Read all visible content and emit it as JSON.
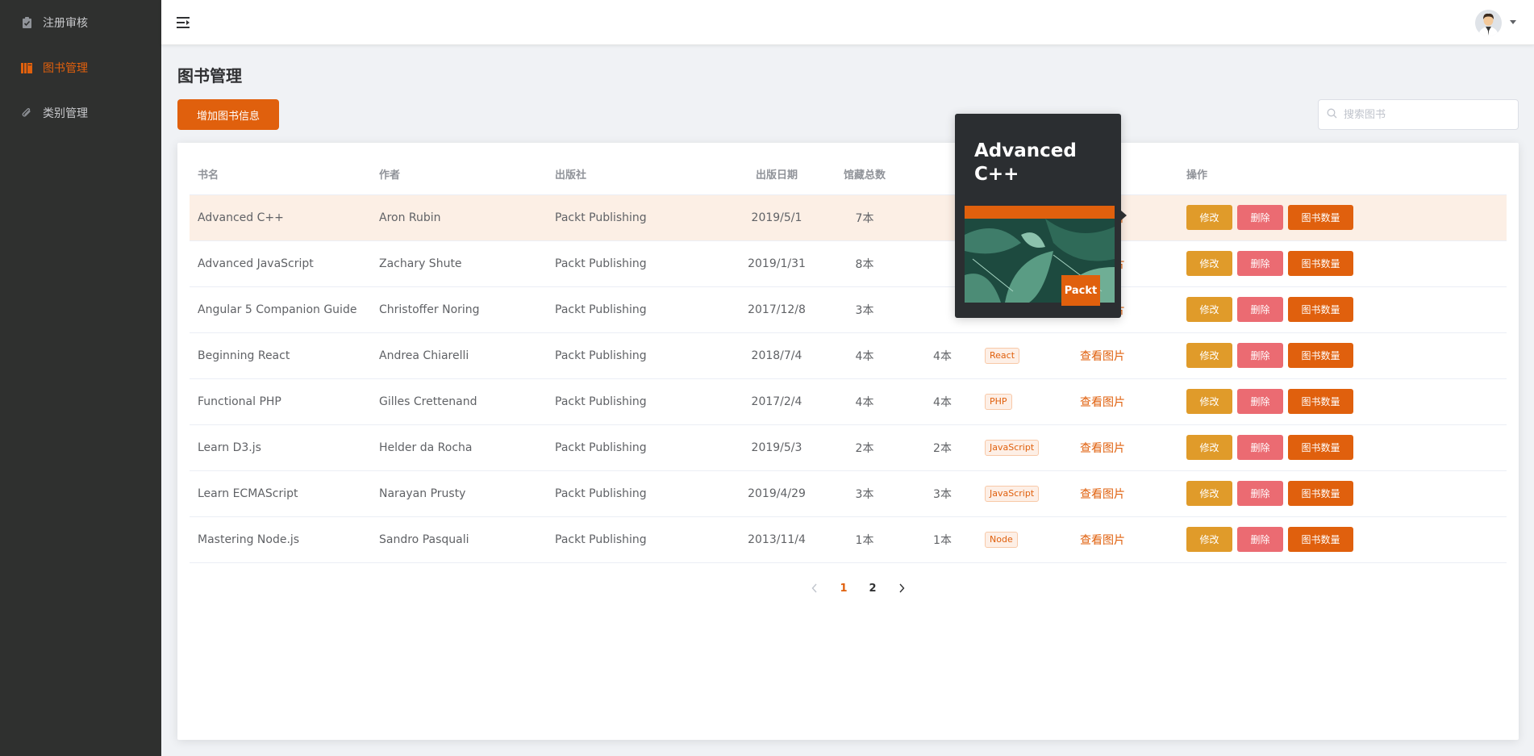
{
  "sidebar": {
    "items": [
      {
        "label": "注册审核",
        "icon": "clipboard-check-icon"
      },
      {
        "label": "图书管理",
        "icon": "book-icon",
        "active": true
      },
      {
        "label": "类别管理",
        "icon": "paperclip-icon"
      }
    ]
  },
  "header": {
    "menu_icon": "hamburger-collapse-icon",
    "avatar": "user-avatar"
  },
  "page": {
    "title": "图书管理",
    "add_button": "增加图书信息",
    "search_placeholder": "搜索图书"
  },
  "table": {
    "columns": [
      "书名",
      "作者",
      "出版社",
      "出版日期",
      "馆藏总数",
      "",
      "",
      "查看图片",
      "操作"
    ],
    "rows": [
      {
        "name": "Advanced C++",
        "author": "Aron Rubin",
        "publisher": "Packt Publishing",
        "date": "2019/5/1",
        "total": "7本",
        "stock": "",
        "category": "",
        "view": "查看图片"
      },
      {
        "name": "Advanced JavaScript",
        "author": "Zachary Shute",
        "publisher": "Packt Publishing",
        "date": "2019/1/31",
        "total": "8本",
        "stock": "",
        "category": "",
        "view": "查看图片"
      },
      {
        "name": "Angular 5 Companion Guide",
        "author": "Christoffer Noring",
        "publisher": "Packt Publishing",
        "date": "2017/12/8",
        "total": "3本",
        "stock": "",
        "category": "",
        "view": "查看图片"
      },
      {
        "name": "Beginning React",
        "author": "Andrea Chiarelli",
        "publisher": "Packt Publishing",
        "date": "2018/7/4",
        "total": "4本",
        "stock": "4本",
        "category": "React",
        "view": "查看图片"
      },
      {
        "name": "Functional PHP",
        "author": "Gilles Crettenand",
        "publisher": "Packt Publishing",
        "date": "2017/2/4",
        "total": "4本",
        "stock": "4本",
        "category": "PHP",
        "view": "查看图片"
      },
      {
        "name": "Learn D3.js",
        "author": "Helder da Rocha",
        "publisher": "Packt Publishing",
        "date": "2019/5/3",
        "total": "2本",
        "stock": "2本",
        "category": "JavaScript",
        "view": "查看图片"
      },
      {
        "name": "Learn ECMAScript",
        "author": "Narayan Prusty",
        "publisher": "Packt Publishing",
        "date": "2019/4/29",
        "total": "3本",
        "stock": "3本",
        "category": "JavaScript",
        "view": "查看图片"
      },
      {
        "name": "Mastering Node.js",
        "author": "Sandro Pasquali",
        "publisher": "Packt Publishing",
        "date": "2013/11/4",
        "total": "1本",
        "stock": "1本",
        "category": "Node",
        "view": "查看图片"
      }
    ],
    "actions": {
      "edit": "修改",
      "delete": "删除",
      "count": "图书数量"
    }
  },
  "pagination": {
    "pages": [
      "1",
      "2"
    ],
    "current": "1"
  },
  "popover": {
    "cover_title": "Advanced C++",
    "publisher_logo": "Packt"
  },
  "colors": {
    "accent": "#e0600d",
    "sidebar_bg": "#2f302f",
    "edit": "#e09b2a",
    "delete": "#eb6b72",
    "row_hover": "#fcefe5"
  }
}
